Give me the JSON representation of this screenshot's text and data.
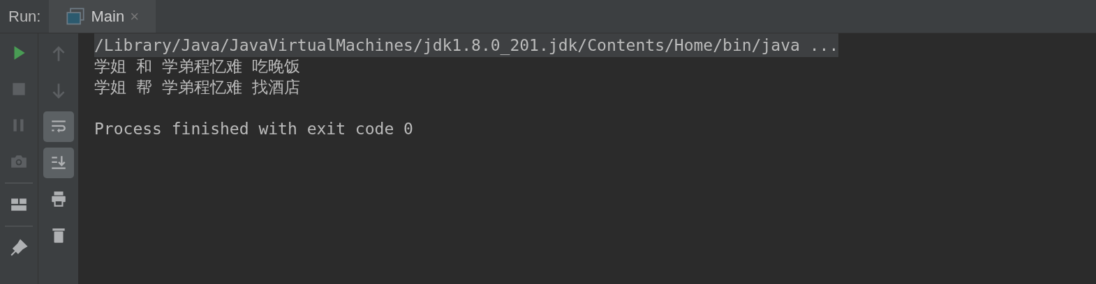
{
  "panel_title": "Run:",
  "tabs": [
    {
      "label": "Main",
      "selected": true,
      "close": "×"
    }
  ],
  "left_toolbar": [
    {
      "kind": "run",
      "disabled": false
    },
    {
      "kind": "stop",
      "disabled": true
    },
    {
      "kind": "pause",
      "disabled": true
    },
    {
      "kind": "camera",
      "disabled": true
    },
    {
      "kind": "separator"
    },
    {
      "kind": "layout",
      "disabled": false
    },
    {
      "kind": "separator"
    },
    {
      "kind": "pin",
      "disabled": false
    }
  ],
  "right_toolbar": [
    {
      "kind": "up",
      "disabled": true,
      "toggled": false
    },
    {
      "kind": "down",
      "disabled": true,
      "toggled": false
    },
    {
      "kind": "wrap",
      "disabled": false,
      "toggled": true
    },
    {
      "kind": "scroll-end",
      "disabled": false,
      "toggled": true
    },
    {
      "kind": "print",
      "disabled": false,
      "toggled": false
    },
    {
      "kind": "trash",
      "disabled": false,
      "toggled": false
    }
  ],
  "console_lines": [
    {
      "text": "/Library/Java/JavaVirtualMachines/jdk1.8.0_201.jdk/Contents/Home/bin/java ...",
      "highlighted": true
    },
    {
      "text": "学姐 和 学弟程忆难 吃晚饭",
      "highlighted": false
    },
    {
      "text": "学姐 帮 学弟程忆难 找酒店",
      "highlighted": false
    },
    {
      "text": "Process finished with exit code 0",
      "highlighted": false,
      "gap_before": true
    }
  ]
}
